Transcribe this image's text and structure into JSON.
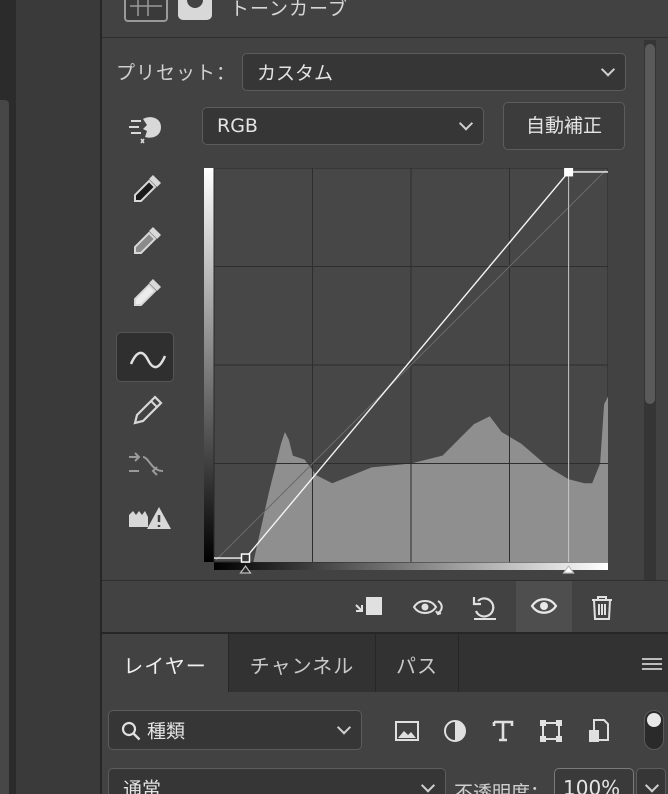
{
  "panel": {
    "title": "トーンカーブ"
  },
  "preset": {
    "label": "プリセット：",
    "value": "カスタム"
  },
  "channel": {
    "value": "RGB"
  },
  "auto_button": {
    "label": "自動補正"
  },
  "tools": [
    {
      "name": "target-adjust-hand-icon"
    },
    {
      "name": "black-point-eyedropper-icon"
    },
    {
      "name": "gray-point-eyedropper-icon"
    },
    {
      "name": "white-point-eyedropper-icon"
    },
    {
      "name": "curve-point-edit-icon",
      "selected": true
    },
    {
      "name": "pencil-draw-icon"
    },
    {
      "name": "smooth-curve-icon"
    },
    {
      "name": "clipping-warning-icon"
    }
  ],
  "curve": {
    "points": [
      [
        0.08,
        0.01
      ],
      [
        0.9,
        0.99
      ]
    ],
    "input_sliders": [
      0.08,
      0.9
    ]
  },
  "bottom_toolbar": [
    {
      "name": "clip-to-layer-icon"
    },
    {
      "name": "view-previous-state-icon"
    },
    {
      "name": "reset-adjustments-icon"
    },
    {
      "name": "toggle-visibility-icon",
      "selected": true
    },
    {
      "name": "delete-adjustment-icon"
    }
  ],
  "layers_panel": {
    "tabs": [
      "レイヤー",
      "チャンネル",
      "パス"
    ],
    "active_tab": 0,
    "filter_kind": "種類",
    "blend_mode": "通常",
    "opacity_label": "不透明度：",
    "opacity_value": "100%"
  },
  "colors": {
    "panel_bg": "#424242",
    "graph_bg": "#474747",
    "histogram": "#8f8f8f"
  }
}
